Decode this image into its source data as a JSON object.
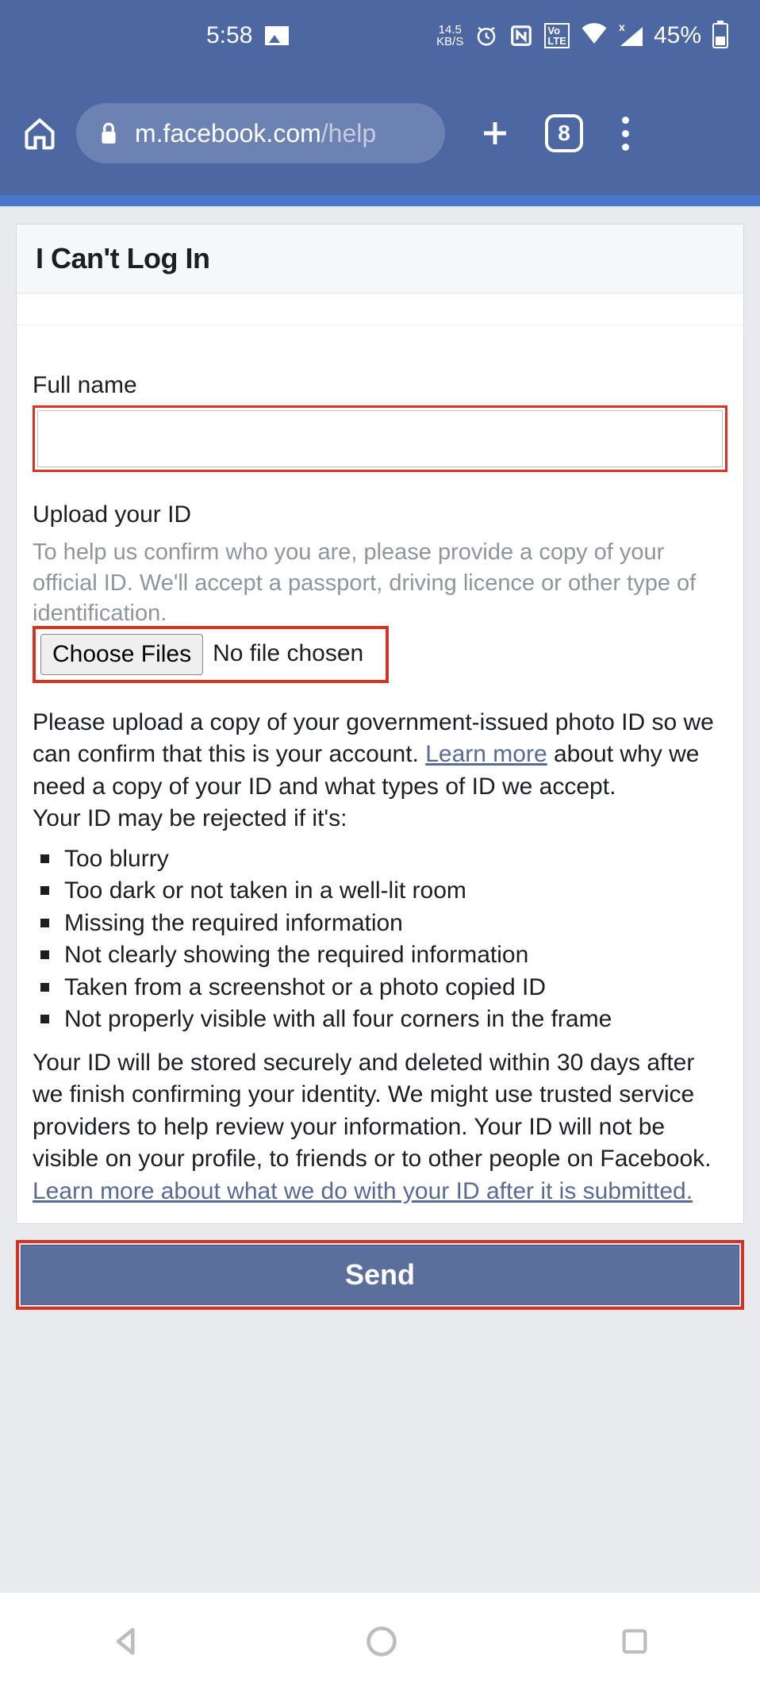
{
  "status": {
    "time": "5:58",
    "kbs_value": "14.5",
    "kbs_unit": "KB/S",
    "volte": "Vo \nLTE",
    "signal_x": "x",
    "battery_pct": "45%"
  },
  "browser": {
    "url_domain": "m.facebook.com",
    "url_path": "/help",
    "tab_count": "8"
  },
  "page": {
    "title": "I Can't Log In",
    "full_name_label": "Full name",
    "full_name_value": "",
    "upload_label": "Upload your ID",
    "upload_hint": "To help us confirm who you are, please provide a copy of your official ID. We'll accept a passport, driving licence or other type of identification.",
    "choose_files_btn": "Choose Files",
    "no_file_chosen": "No file chosen",
    "para1_a": "Please upload a copy of your government-issued photo ID so we can confirm that this is your account. ",
    "learn_more": "Learn more",
    "para1_b": " about why we need a copy of your ID and what types of ID we accept.",
    "rejected_intro": "Your ID may be rejected if it's:",
    "bullets": [
      "Too blurry",
      "Too dark or not taken in a well-lit room",
      "Missing the required information",
      "Not clearly showing the required information",
      "Taken from a screenshot or a photo copied ID",
      "Not properly visible with all four corners in the frame"
    ],
    "storage_para": "Your ID will be stored securely and deleted within 30 days after we finish confirming your identity. We might use trusted service providers to help review your information. Your ID will not be visible on your profile, to friends or to other people on Facebook.",
    "learn_link": "Learn more about what we do with your ID after it is submitted.",
    "send_btn": "Send"
  }
}
